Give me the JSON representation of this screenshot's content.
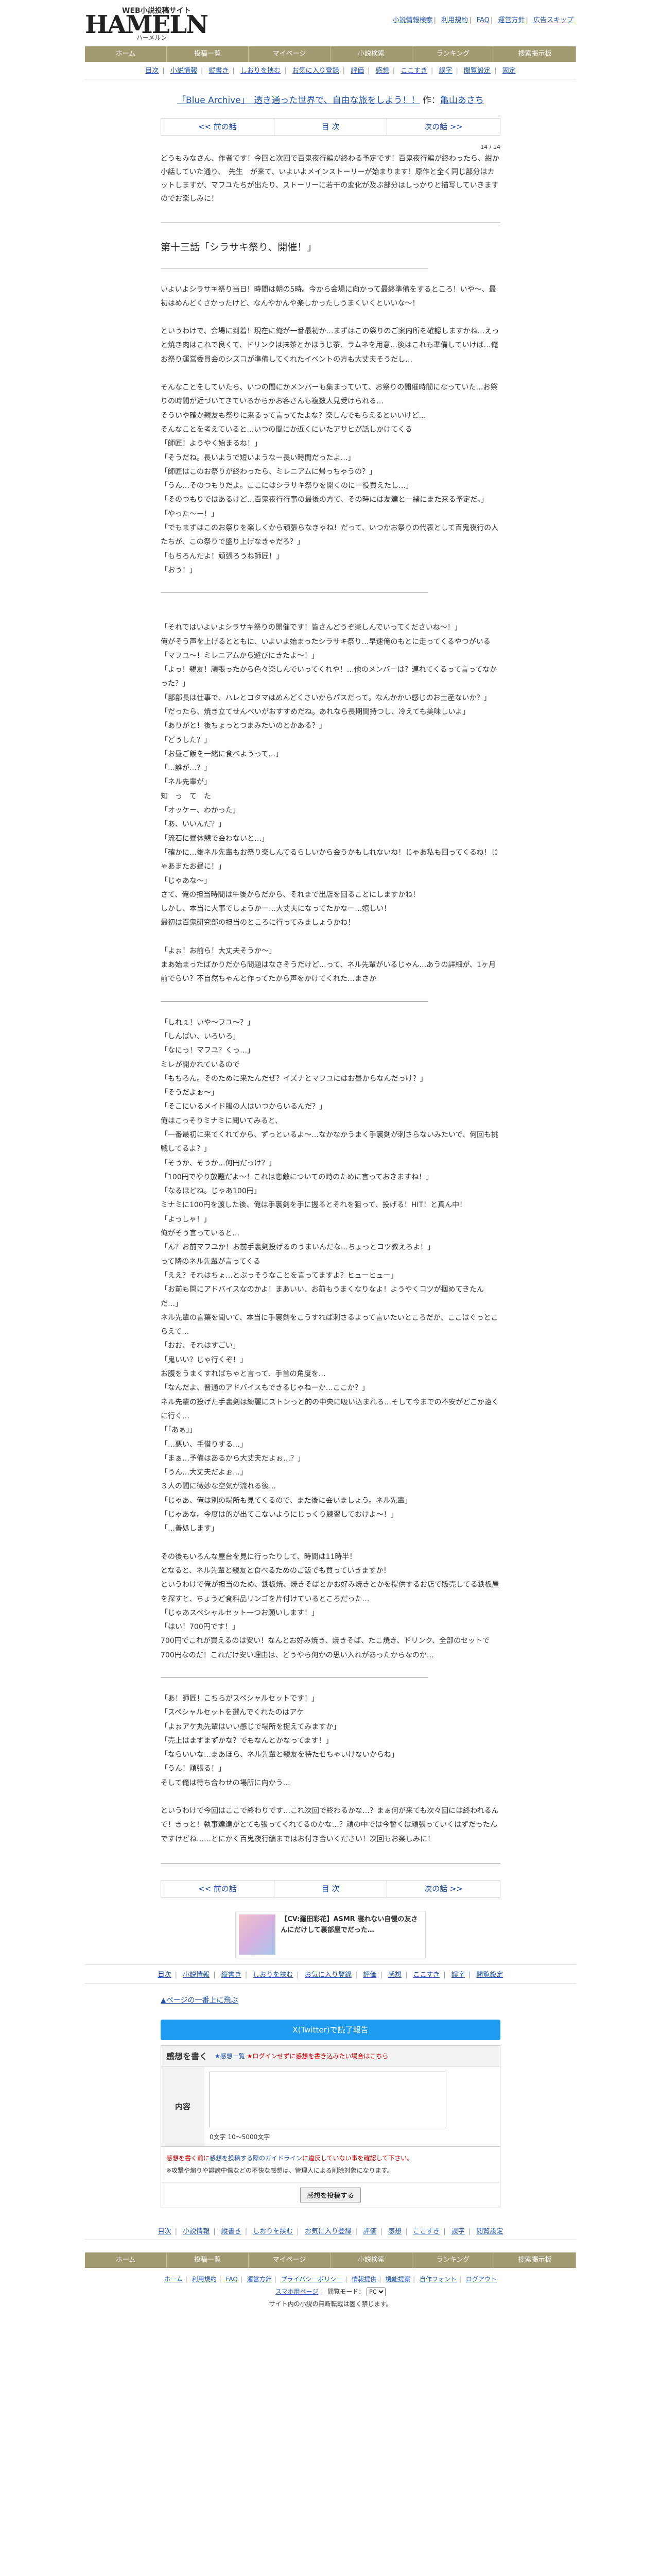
{
  "header": {
    "logo_sub": "WEB小説投稿サイト",
    "logo_main": "HAMELN",
    "logo_kana": "ハーメルン",
    "links": [
      "小説情報検索",
      "利用規約",
      "FAQ",
      "運営方針",
      "広告スキップ"
    ]
  },
  "nav": [
    "ホーム",
    "投稿一覧",
    "マイページ",
    "小説検索",
    "ランキング",
    "捜索掲示板"
  ],
  "subnav": [
    "目次",
    "小説情報",
    "縦書き",
    "しおりを挟む",
    "お気に入り登録",
    "評価",
    "感想",
    "ここすき",
    "誤字",
    "閲覧設定",
    "固定"
  ],
  "novel": {
    "title": "「Blue Archive」　透き通った世界で、自由な旅をしよう！！",
    "author_label": "作：",
    "author": "亀山あさち"
  },
  "pager": {
    "prev": "<< 前の話",
    "index": "目 次",
    "next": "次の話 >>"
  },
  "page_number": "14 / 14",
  "preface": "どうもみなさん、作者です！今回と次回で百鬼夜行編が終わる予定です！百鬼夜行編が終わったら、紺か小話していた通り、　先生　が来て、いよいよメインストーリーが始まります！原作と全く同じ部分はカットしますが、マフユたちが出たり、ストーリーに若干の変化が及ぶ部分はしっかりと描写していきますのでお楽しみに！",
  "chapter_title": "第十三話「シラサキ祭り、開催！」",
  "paragraphs": [
    "いよいよシラサキ祭り当日！時間は朝の5時。今から会場に向かって最終準備をするところ！いや〜、最初はめんどくさかったけど、なんやかんや楽しかったしうまくいくといいな〜！",
    "",
    "というわけで、会場に到着！現在に俺が一番最初か…まずはこの祭りのご案内所を確認しますかね…えっと焼き肉はこれで良くて、ドリンクは抹茶とかほうじ茶、ラムネを用意…後はこれも準備していけば…俺お祭り運営委員会のシズコが準備してくれたイベントの方も大丈夫そうだし…",
    "",
    "そんなことをしていたら、いつの間にかメンバーも集まっていて、お祭りの開催時間になっていた…お祭りの時間が近づいてきているからかお客さんも複数人見受けられる…",
    "そういや確か親友も祭りに来るって言ってたよな？楽しんでもらえるといいけど…",
    "そんなことを考えていると…いつの間にか近くにいたアサヒが話しかけてくる",
    "「師匠！ようやく始まるね！」",
    "「そうだね。長いようで短いようなー長い時間だったよ…」",
    "「師匠はこのお祭りが終わったら、ミレニアムに帰っちゃうの？」",
    "「うん…そのつもりだよ。ここにはシラサキ祭りを開くのに一役買えたし…」",
    "「そのつもりではあるけど…百鬼夜行行事の最後の方で、その時には友達と一緒にまた来る予定だ。」",
    "「やった〜ー！」",
    "「でもまずはこのお祭りを楽しくから頑張らなきゃね！だって、いつかお祭りの代表として百鬼夜行の人たちが、この祭りで盛り上げなきゃだろ？」",
    "「もちろんだよ！頑張ろうね師匠！」",
    "「おう！」",
    "",
    "「それではいよいよシラサキ祭りの開催です！皆さんどうぞ楽しんでいってくださいね〜！」",
    "俺がそう声を上げるとともに、いよいよ始まったシラサキ祭り…早速俺のもとに走ってくるやつがいる",
    "「マフユ〜！ミレニアムから遊びにきたよ〜！」",
    "「よっ！親友！頑張ったから色々楽しんでいってくれや！…他のメンバーは？連れてくるって言ってなかった？」",
    "「部部長は仕事で、ハレとコタマはめんどくさいからパスだって。なんかかい感じのお土産ないか？」",
    "「だったら、焼き立てせんべいがおすすめだね。あれなら長期間持つし、冷えても美味しいよ」",
    "「ありがと！後ちょっとつまみたいのとかある？」",
    "「どうした？」",
    "「お昼ご飯を一緒に食べようって…」",
    "「…誰が…？」",
    "「ネル先輩が」",
    "知　っ　て　た",
    "「オッケー、わかった」",
    "「あ、いいんだ？」",
    "「流石に昼休憩で会わないと…」",
    "「確かに…後ネル先輩もお祭り楽しんでるらしいから会うかもしれないね！じゃあ私も回ってくるね！じゃあまたお昼に！」",
    "「じゃあな〜」",
    "さて、俺の担当時間は午後からだから、それまで出店を回ることにしますかね！",
    "しかし、本当に大事でしょうかー…大丈夫になってたかなー…嬉しい！",
    "最初は百鬼研究部の担当のところに行ってみましょうかね！",
    "",
    "「よぉ！お前ら！大丈夫そうか〜」",
    "まあ始まったばかりだから問題はなさそうだけど…って、ネル先輩がいるじゃん…あうの詳細が、1ヶ月前でらい？不自然ちゃんと作ってたから声をかけてくれた…まさか",
    "「しれぇ！いや〜フユ〜？」",
    "「しんぱい、いろいろ」",
    "「なにっ！マフユ？くっ…」",
    "ミレが開かれているので",
    "「もちろん。そのために来たんだぜ？イズナとマフユにはお昼からなんだっけ？」",
    "「そうだよぉ〜」",
    "「そこにいるメイド服の人はいつからいるんだ？」",
    "俺はこっそりミナミに聞いてみると、",
    "「一番最初に来てくれてから、ずっといるよ〜…なかなかうまく手裏剣が刺さらないみたいで、何回も挑戦してるよ？」",
    "「そうか、そうか…何円だっけ？」",
    "「100円でやり放題だよ〜！これは恋敵についての時のために言っておきますね！」",
    "「なるほどね。じゃあ100円」",
    "ミナミに100円を渡した後、俺は手裏剣を手に握るとそれを狙って、投げる！HIT！と真ん中！",
    "「よっしゃ！」",
    "俺がそう言っていると…",
    "「ん？お前マフユか！お前手裏剣投げるのうまいんだな…ちょっとコツ教えろよ！」",
    "って隣のネル先輩が言ってくる",
    "「ええ？それはちょ…とぶっそうなことを言ってますよ？ヒューヒュー」",
    "「お前も問にアドバイスなのかよ！まあいい、お前もうまくなりなよ！ようやくコツが掴めてきたんだ…」",
    "ネル先輩の言葉を聞いて、本当に手裏剣をこうすれば刺さるよって言いたいところだが、ここはぐっとこらえて…",
    "「おお、それはすごい」",
    "「鬼いい？じゃ行くぞ！」",
    "お腹をうまくすればちゃと言って、手首の角度を…",
    "「なんだよ、普通のアドバイスもできるじゃねーか…ここか？」",
    "ネル先輩の投げた手裏剣は綺麗にストンっと的の中央に吸い込まれる…そして今までの不安がどこか遠くに行く…",
    "「「あぁ」」",
    "「…悪い、手借りする…」",
    "「まぁ…予備はあるから大丈夫だよぉ…？」",
    "「うん…大丈夫だよぉ…」",
    "３人の間に微妙な空気が流れる後…",
    "「じゃあ、俺は別の場所も見てくるので、また後に会いましょう。ネル先輩」",
    "「じゃあな。今度は的が出てこないようにじっくり練習しておけよ〜！」",
    "「…善処します」",
    "",
    "その後もいろんな屋台を見に行ったりして、時間は11時半！",
    "となると、ネル先輩と親友と食べるためのご飯でも買っていきますか！",
    "というわけで俺が担当のため、鉄板焼、焼きそばとかお好み焼きとかを提供するお店で販売してる鉄板屋を探すと、ちょうど食料品リンゴを片付けているところだった…",
    "「じゃあスペシャルセット一つお願いします！」",
    "「はい！700円です！」",
    "700円でこれが買えるのは安い！なんとお好み焼き、焼きそば、たこ焼き、ドリンク、全部のセットで700円なのだ！これだけ安い理由は、どうやら何かの思い入れがあったからなのか…",
    "「あ！師匠！こちらがスペシャルセットです！」",
    "「スペシャルセットを選んでくれたのはアケ",
    "「よぉアケ丸先輩はいい感じで場所を捉えてみますか」",
    "「売上はまずまずかな？でもなんとかなってます！」",
    "「ならいいな…まあほら、ネル先輩と親友を待たせちゃいけないからね」",
    "「うん！頑張る！」",
    "そして俺は待ち合わせの場所に向かう…",
    "",
    "というわけで今回はここで終わりです…これ次回で終わるかな…？まぁ何が来ても次々回には終われるんで！きっと！執事達達がとても張ってくれてるのかな…？頑の中では今暫くは頑張っていくはずだったんですけどね……とにかく百鬼夜行編まではお付き合いください！次回もお楽しみに！"
  ],
  "ad": {
    "text": "【CV:羅田彩花】ASMR 寝れない自慢の友さんにだけして裏部屋でだった…"
  },
  "pagetop": "▲ページの一番上に飛ぶ",
  "twitter": "X(Twitter)で読了報告",
  "review": {
    "title": "感想を書く",
    "rule_link": "★感想一覧",
    "login_note": "★ログインせずに感想を書き込みたい場合はこちら",
    "label": "内容",
    "count": "0文字 10〜5000文字",
    "note1": "感想を書く前に",
    "note1_link": "感想を投稿する際のガイドライン",
    "note1_rest": "に違反していない事を確認して下さい。",
    "note2": "※攻撃や煽りや誹謗中傷などの不快な感想は、管理人による削除対象になります。",
    "submit": "感想を投稿する"
  },
  "footer_links": [
    "目次",
    "小説情報",
    "縦書き",
    "しおりを挟む",
    "お気に入り登録",
    "評価",
    "感想",
    "ここすき",
    "誤字",
    "閲覧設定"
  ],
  "footer_bottom": {
    "links": [
      "ホーム",
      "利用規約",
      "FAQ",
      "運営方針",
      "プライバシーポリシー",
      "情報提供",
      "機能提案",
      "自作フォント",
      "ログアウト"
    ],
    "mobile": "スマホ用ページ",
    "display": "閲覧モード：",
    "display_value": "PC",
    "copy": "サイト内の小説の無断転載は固く禁じます。"
  }
}
